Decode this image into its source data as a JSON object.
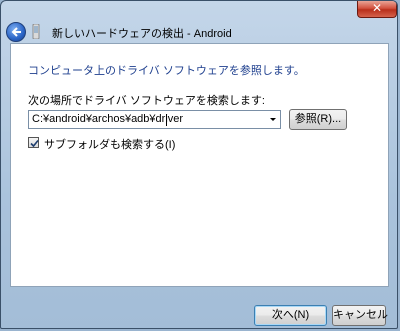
{
  "window": {
    "title": "新しいハードウェアの検出 - Android",
    "close_glyph": "✕"
  },
  "content": {
    "heading": "コンピュータ上のドライバ ソフトウェアを参照します。",
    "search_label": "次の場所でドライバ ソフトウェアを検索します:",
    "path_value": "C:¥android¥archos¥adb¥driver",
    "browse_button": "参照(R)...",
    "include_subfolders_label": "サブフォルダも検索する(I)",
    "include_subfolders_checked": true
  },
  "footer": {
    "next_button": "次へ(N)",
    "cancel_button": "キャンセル"
  },
  "colors": {
    "heading_color": "#1e3f8e",
    "frame": "#aac3dc"
  }
}
